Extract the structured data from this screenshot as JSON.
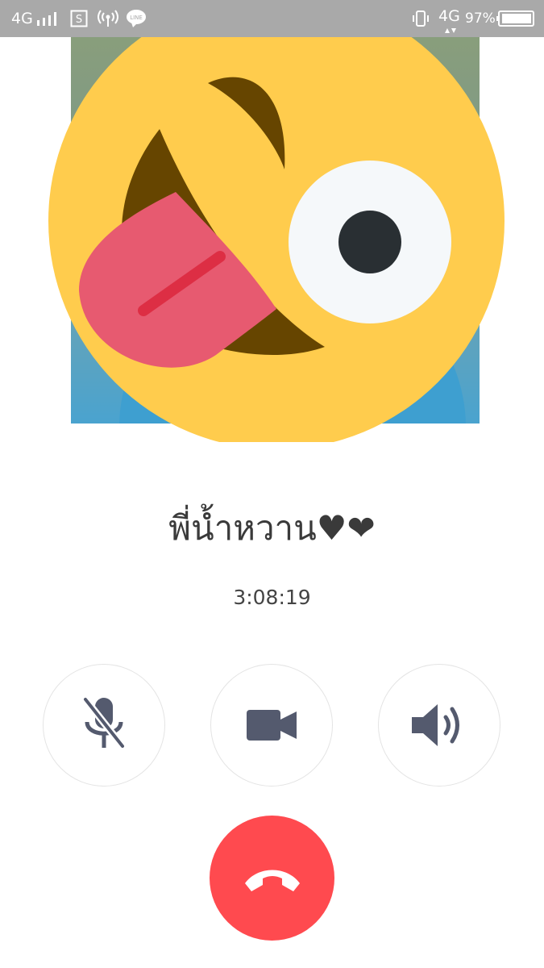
{
  "status_bar": {
    "network_left": "4G",
    "app_notif_letter": "S",
    "line_label": "LINE",
    "network_right": "4G",
    "battery_percent": "97%"
  },
  "call": {
    "caller_name": "พี่น้ำหวาน♥❤",
    "duration": "3:08:19"
  },
  "controls": {
    "mute": "microphone-muted-icon",
    "video": "video-camera-icon",
    "speaker": "speaker-icon",
    "end_call": "hang-up-icon"
  },
  "colors": {
    "status_bar_bg": "#a9a9a9",
    "end_call_red": "#ff4a4f",
    "icon_slate": "#545a6e",
    "emoji_yellow": "#ffcc4d"
  }
}
